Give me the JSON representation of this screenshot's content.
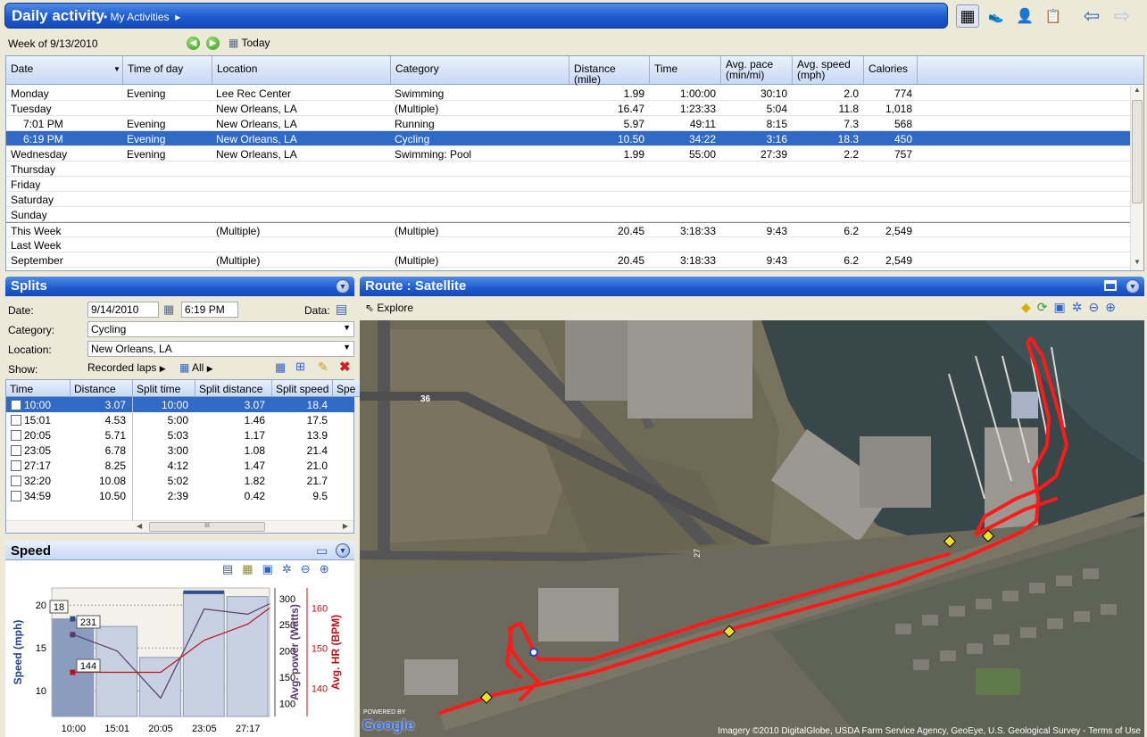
{
  "header": {
    "title": "Daily activity",
    "breadcrumb": "My Activities",
    "nav": {
      "back": "back-arrow",
      "forward": "forward-arrow"
    }
  },
  "toolbar": {
    "week_label": "Week of 9/13/2010",
    "today_label": "Today"
  },
  "activity_table": {
    "columns": [
      "Date",
      "Time of day",
      "Location",
      "Category",
      "Distance (mile)",
      "Time",
      "Avg. pace\n(min/mi)",
      "Avg. speed\n(mph)",
      "Calories"
    ],
    "rows": [
      {
        "date": "Monday",
        "tod": "Evening",
        "loc": "Lee Rec Center",
        "cat": "Swimming",
        "dist": "1.99",
        "time": "1:00:00",
        "pace": "30:10",
        "speed": "2.0",
        "cal": "774"
      },
      {
        "date": "Tuesday",
        "tod": "",
        "loc": "New Orleans, LA",
        "cat": "(Multiple)",
        "dist": "16.47",
        "time": "1:23:33",
        "pace": "5:04",
        "speed": "11.8",
        "cal": "1,018"
      },
      {
        "date": "7:01 PM",
        "tod": "Evening",
        "loc": "New Orleans, LA",
        "cat": "Running",
        "dist": "5.97",
        "time": "49:11",
        "pace": "8:15",
        "speed": "7.3",
        "cal": "568"
      },
      {
        "date": "6:19 PM",
        "tod": "Evening",
        "loc": "New Orleans, LA",
        "cat": "Cycling",
        "dist": "10.50",
        "time": "34:22",
        "pace": "3:16",
        "speed": "18.3",
        "cal": "450"
      },
      {
        "date": "Wednesday",
        "tod": "Evening",
        "loc": "New Orleans, LA",
        "cat": "Swimming: Pool",
        "dist": "1.99",
        "time": "55:00",
        "pace": "27:39",
        "speed": "2.2",
        "cal": "757"
      },
      {
        "date": "Thursday",
        "tod": "",
        "loc": "",
        "cat": "",
        "dist": "",
        "time": "",
        "pace": "",
        "speed": "",
        "cal": ""
      },
      {
        "date": "Friday",
        "tod": "",
        "loc": "",
        "cat": "",
        "dist": "",
        "time": "",
        "pace": "",
        "speed": "",
        "cal": ""
      },
      {
        "date": "Saturday",
        "tod": "",
        "loc": "",
        "cat": "",
        "dist": "",
        "time": "",
        "pace": "",
        "speed": "",
        "cal": ""
      },
      {
        "date": "Sunday",
        "tod": "",
        "loc": "",
        "cat": "",
        "dist": "",
        "time": "",
        "pace": "",
        "speed": "",
        "cal": ""
      },
      {
        "date": "This Week",
        "tod": "",
        "loc": "(Multiple)",
        "cat": "(Multiple)",
        "dist": "20.45",
        "time": "3:18:33",
        "pace": "9:43",
        "speed": "6.2",
        "cal": "2,549"
      },
      {
        "date": "Last Week",
        "tod": "",
        "loc": "",
        "cat": "",
        "dist": "",
        "time": "",
        "pace": "",
        "speed": "",
        "cal": ""
      },
      {
        "date": "September",
        "tod": "",
        "loc": "(Multiple)",
        "cat": "(Multiple)",
        "dist": "20.45",
        "time": "3:18:33",
        "pace": "9:43",
        "speed": "6.2",
        "cal": "2,549"
      }
    ]
  },
  "splits": {
    "title": "Splits",
    "date_label": "Date:",
    "date_value": "9/14/2010",
    "time_value": "6:19 PM",
    "data_label": "Data:",
    "category_label": "Category:",
    "category_value": "Cycling",
    "location_label": "Location:",
    "location_value": "New Orleans, LA",
    "show_label": "Show:",
    "show_value": "Recorded laps",
    "all_label": "All",
    "columns": [
      "Time",
      "Distance",
      "Split time",
      "Split distance",
      "Split speed",
      "Spe"
    ],
    "rows": [
      {
        "time": "10:00",
        "dist": "3.07",
        "stime": "10:00",
        "sdist": "3.07",
        "sspeed": "18.4"
      },
      {
        "time": "15:01",
        "dist": "4.53",
        "stime": "5:00",
        "sdist": "1.46",
        "sspeed": "17.5"
      },
      {
        "time": "20:05",
        "dist": "5.71",
        "stime": "5:03",
        "sdist": "1.17",
        "sspeed": "13.9"
      },
      {
        "time": "23:05",
        "dist": "6.78",
        "stime": "3:00",
        "sdist": "1.08",
        "sspeed": "21.4"
      },
      {
        "time": "27:17",
        "dist": "8.25",
        "stime": "4:12",
        "sdist": "1.47",
        "sspeed": "21.0"
      },
      {
        "time": "32:20",
        "dist": "10.08",
        "stime": "5:02",
        "sdist": "1.82",
        "sspeed": "21.7"
      },
      {
        "time": "34:59",
        "dist": "10.50",
        "stime": "2:39",
        "sdist": "0.42",
        "sspeed": "9.5"
      }
    ]
  },
  "speed_panel": {
    "title": "Speed"
  },
  "chart_data": {
    "type": "bar",
    "categories": [
      "10:00",
      "15:01",
      "20:05",
      "23:05",
      "27:17"
    ],
    "values": [
      18.4,
      17.5,
      13.9,
      21.4,
      21.0
    ],
    "series": [
      {
        "name": "Avg. power (Watts)",
        "values": [
          231,
          200,
          110,
          280,
          270
        ]
      },
      {
        "name": "Avg. HR (BPM)",
        "values": [
          144,
          144,
          144,
          152,
          156
        ]
      }
    ],
    "ylabel": "Speed (mph)",
    "y2label": "Avg. power (Watts)",
    "y3label": "Avg. HR (BPM)",
    "y_ticks": [
      "20",
      "15",
      "10"
    ],
    "y2_ticks": [
      "300",
      "250",
      "200",
      "150",
      "100"
    ],
    "y3_ticks": [
      "160",
      "150",
      "140"
    ],
    "callouts": [
      "18",
      "231",
      "144"
    ],
    "colors": {
      "bar": "#c7d1e2",
      "bar_hl": "#8b9dbe",
      "power": "#5a3a6e",
      "hr": "#c0101a"
    }
  },
  "route_panel": {
    "title": "Route : Satellite",
    "explore_label": "Explore",
    "attribution": "Imagery ©2010 DigitalGlobe, USDA Farm Service Agency, GeoEye, U.S. Geological Survey - Terms of Use",
    "powered_by": "POWERED BY",
    "google": "Google",
    "map_labels": [
      "36",
      "27"
    ]
  }
}
